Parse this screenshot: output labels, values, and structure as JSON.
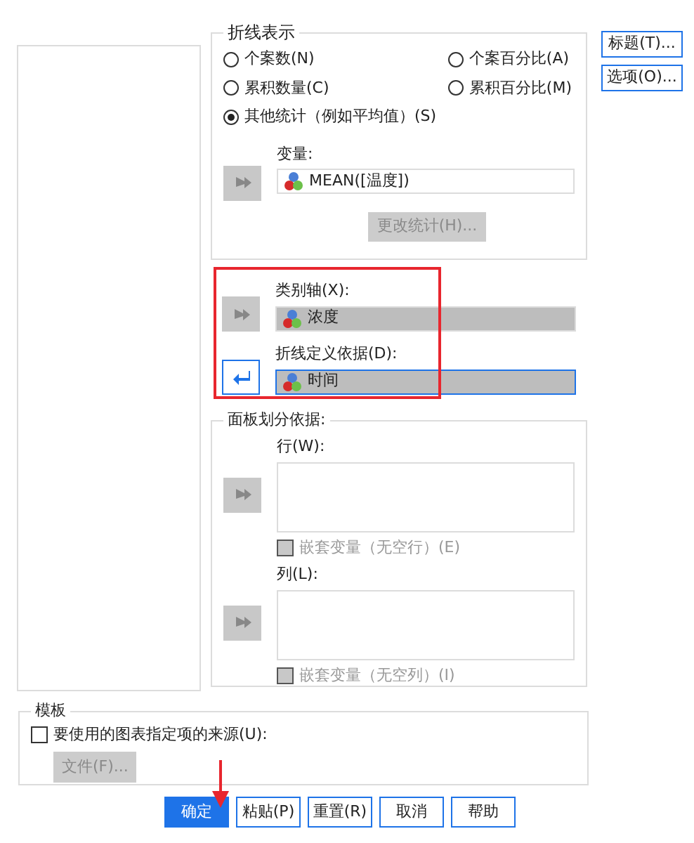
{
  "line_display": {
    "title": "折线表示",
    "options": [
      {
        "label": "个案数(N)",
        "selected": false
      },
      {
        "label": "个案百分比(A)",
        "selected": false
      },
      {
        "label": "累积数量(C)",
        "selected": false
      },
      {
        "label": "累积百分比(M)",
        "selected": false
      },
      {
        "label": "其他统计（例如平均值）(S)",
        "selected": true
      }
    ],
    "variable": {
      "label": "变量:",
      "arrow": {
        "kind": "move",
        "enabled": false
      },
      "value": "MEAN([温度])",
      "focused": false
    },
    "change_statistic": {
      "label": "更改统计(H)...",
      "disabled": true
    }
  },
  "side_buttons": [
    "标题(T)...",
    "选项(O)..."
  ],
  "category_axis": {
    "label": "类别轴(X):",
    "arrow": {
      "kind": "move",
      "enabled": false
    },
    "value": "浓度",
    "focused": false
  },
  "line_definition": {
    "label": "折线定义依据(D):",
    "arrow": {
      "kind": "return",
      "enabled": true
    },
    "value": "时间",
    "focused": true
  },
  "panel_by": {
    "title": "面板划分依据:",
    "rows": {
      "label": "行(W):",
      "arrow": {
        "kind": "move",
        "enabled": false
      },
      "nest": {
        "label": "嵌套变量（无空行）(E)",
        "checked": false,
        "disabled": true
      }
    },
    "columns": {
      "label": "列(L):",
      "arrow": {
        "kind": "move",
        "enabled": false
      },
      "nest": {
        "label": "嵌套变量（无空列）(I)",
        "checked": false,
        "disabled": true
      }
    }
  },
  "template": {
    "title": "模板",
    "use_source": {
      "label": "要使用的图表指定项的来源(U):",
      "checked": false,
      "disabled": false
    },
    "file_button": {
      "label": "文件(F)...",
      "disabled": true
    }
  },
  "buttons": [
    {
      "label": "确定",
      "default": true
    },
    {
      "label": "粘贴(P)",
      "default": false
    },
    {
      "label": "重置(R)",
      "default": false
    },
    {
      "label": "取消",
      "default": false
    },
    {
      "label": "帮助",
      "default": false
    }
  ]
}
